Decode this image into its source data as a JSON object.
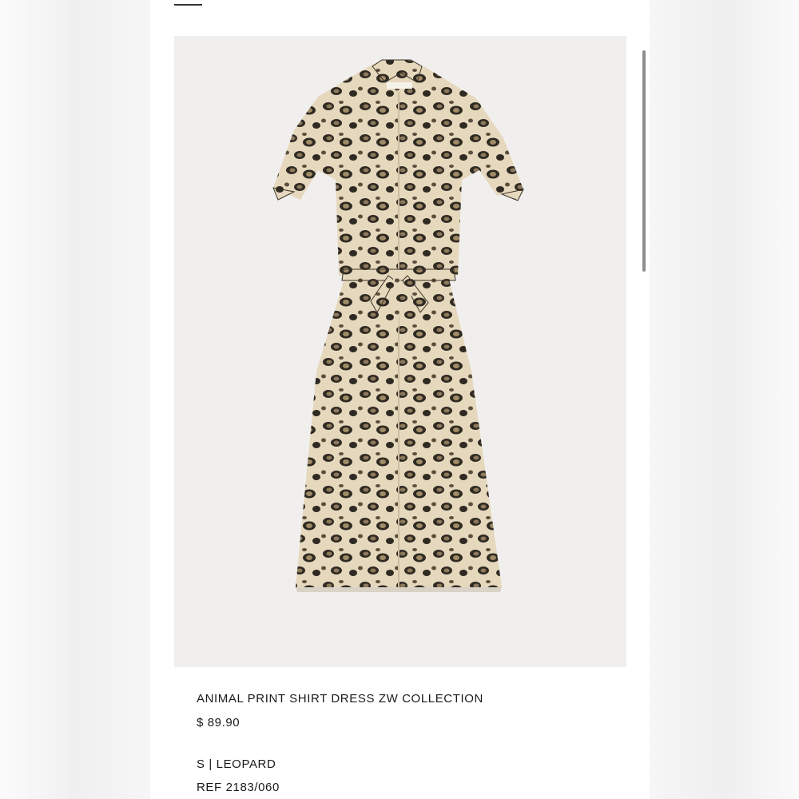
{
  "product": {
    "name": "ANIMAL PRINT SHIRT DRESS ZW COLLECTION",
    "price": "$ 89.90",
    "variant": "S | LEOPARD",
    "reference": "REF 2183/060",
    "image": "product-photo-leopard-dress"
  },
  "icons": {
    "menu": "menu-icon"
  },
  "colors": {
    "image_background": "#f1efee",
    "print_base": "#e6d8bd",
    "print_spot_dark": "#2f2a22",
    "print_spot_tan": "#8d7a5c",
    "text": "#1a1a1a"
  }
}
